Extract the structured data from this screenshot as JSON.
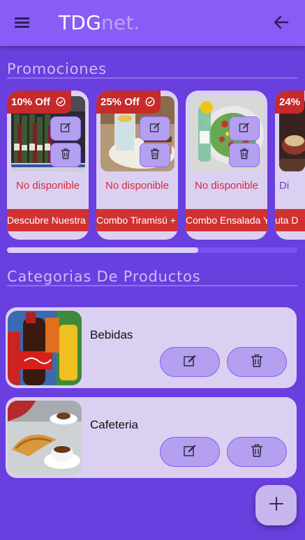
{
  "header": {
    "brand_main": "TDG",
    "brand_suffix": "net.",
    "menu_icon": "hamburger-menu-icon",
    "back_icon": "arrow-left-icon"
  },
  "promotions": {
    "title": "Promociones",
    "items": [
      {
        "discount": "10% Off",
        "status": "No disponible",
        "name": "Descubre Nuestra Selección"
      },
      {
        "discount": "25% Off",
        "status": "No disponible",
        "name": "Combo Tiramisú + Agua"
      },
      {
        "discount": "",
        "status": "No disponible",
        "name": "Combo Ensalada Y Gaseosa"
      },
      {
        "discount": "24%",
        "status": "Di",
        "name": "uta D"
      }
    ]
  },
  "categories": {
    "title": "Categorias De Productos",
    "items": [
      {
        "name": "Bebidas"
      },
      {
        "name": "Cafeteria"
      }
    ]
  },
  "colors": {
    "background": "#6a3fdf",
    "header": "#8a5cf6",
    "card": "#dcd0f2",
    "button": "#b49ff0",
    "badge": "#c62a2a",
    "status_text": "#d42b3e"
  },
  "fab_icon": "plus-icon"
}
